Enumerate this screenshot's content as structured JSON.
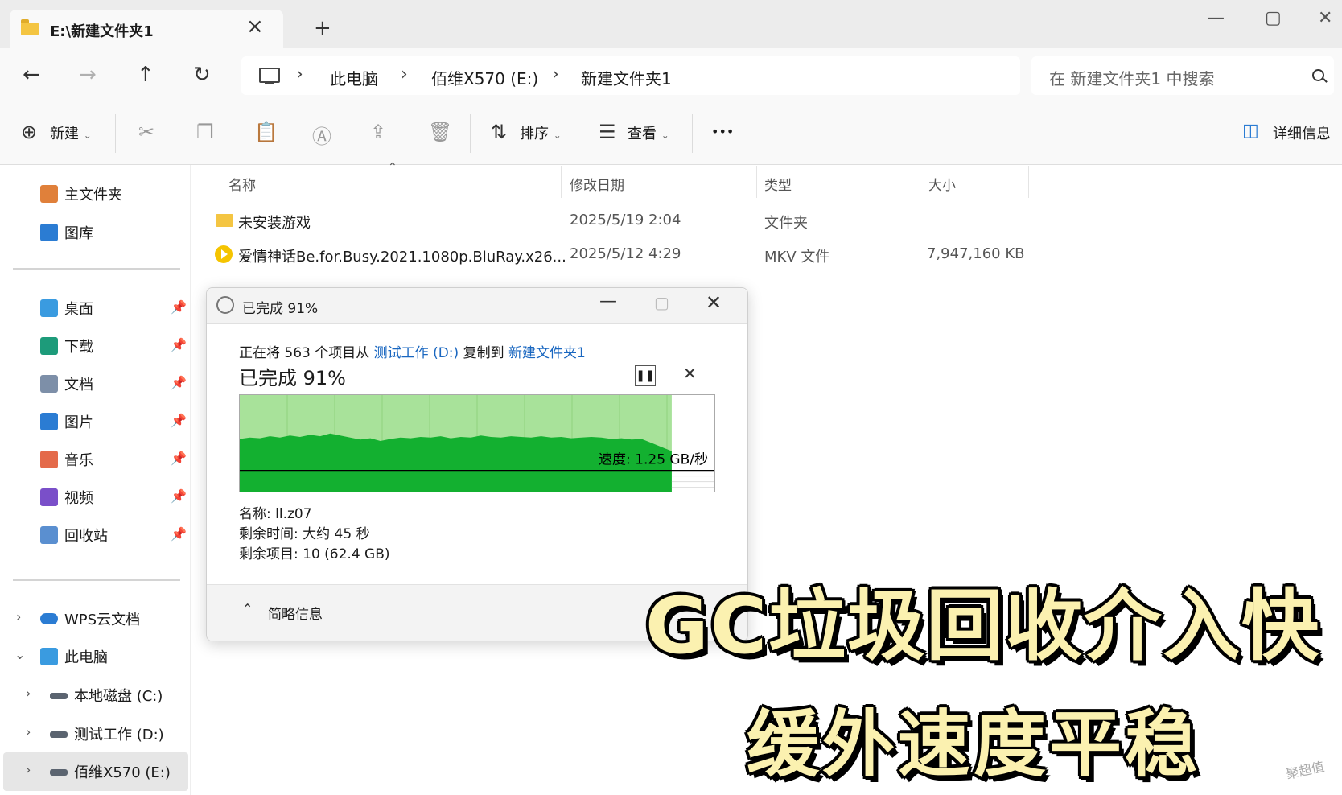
{
  "window": {
    "tab_title": "E:\\新建文件夹1",
    "new_tab": "+",
    "controls": [
      "—",
      "▢",
      "✕"
    ]
  },
  "nav": {
    "breadcrumbs": [
      "此电脑",
      "佰维X570 (E:)",
      "新建文件夹1"
    ],
    "search_placeholder": "在 新建文件夹1 中搜索"
  },
  "commandbar": {
    "new_label": "新建",
    "sort_label": "排序",
    "view_label": "查看",
    "more_label": "•••",
    "details_label": "详细信息"
  },
  "sidebar": {
    "quick": [
      {
        "label": "主文件夹",
        "icon": "home-icon",
        "color": "#e0803a"
      },
      {
        "label": "图库",
        "icon": "gallery-icon",
        "color": "#2b7cd3"
      }
    ],
    "pinned": [
      {
        "label": "桌面",
        "icon": "desktop-icon",
        "color": "#3a9be0"
      },
      {
        "label": "下载",
        "icon": "download-icon",
        "color": "#1d9b7a"
      },
      {
        "label": "文档",
        "icon": "documents-icon",
        "color": "#7d8fa8"
      },
      {
        "label": "图片",
        "icon": "pictures-icon",
        "color": "#2b7cd3"
      },
      {
        "label": "音乐",
        "icon": "music-icon",
        "color": "#e46a4a"
      },
      {
        "label": "视频",
        "icon": "videos-icon",
        "color": "#7a4fc9"
      },
      {
        "label": "回收站",
        "icon": "recycle-bin-icon",
        "color": "#5a8fd0"
      }
    ],
    "tree": [
      {
        "label": "WPS云文档",
        "icon": "cloud-icon"
      },
      {
        "label": "此电脑",
        "icon": "this-pc-icon"
      },
      {
        "label": "本地磁盘 (C:)",
        "icon": "drive-icon"
      },
      {
        "label": "测试工作 (D:)",
        "icon": "drive-icon"
      },
      {
        "label": "佰维X570 (E:)",
        "icon": "drive-icon"
      }
    ]
  },
  "filelist": {
    "columns": [
      "名称",
      "修改日期",
      "类型",
      "大小"
    ],
    "rows": [
      {
        "name": "未安装游戏",
        "date": "2025/5/19 2:04",
        "type": "文件夹",
        "size": ""
      },
      {
        "name": "爱情神话Be.for.Busy.2021.1080p.BluRay.x26...",
        "date": "2025/5/12 4:29",
        "type": "MKV 文件",
        "size": "7,947,160 KB"
      }
    ]
  },
  "dialog": {
    "title": "已完成 91%",
    "line_prefix": "正在将 563 个项目从 ",
    "source": "测试工作 (D:)",
    "line_middle": " 复制到 ",
    "dest": "新建文件夹1",
    "progress_heading": "已完成 91%",
    "progress_fraction": 0.91,
    "speed_label": "速度: 1.25 GB/秒",
    "name_line": "名称:  ll.z07",
    "time_line": "剩余时间: 大约 45 秒",
    "items_line": "剩余项目: 10 (62.4 GB)",
    "footer_label": "简略信息"
  },
  "chart_data": {
    "type": "area",
    "speed_samples": [
      0.78,
      0.8,
      0.79,
      0.82,
      0.8,
      0.83,
      0.81,
      0.84,
      0.82,
      0.86,
      0.83,
      0.8,
      0.77,
      0.79,
      0.75,
      0.78,
      0.8,
      0.79,
      0.81,
      0.8,
      0.82,
      0.79,
      0.81,
      0.8,
      0.83,
      0.81,
      0.8,
      0.82,
      0.81,
      0.8,
      0.82,
      0.8,
      0.81,
      0.79,
      0.8,
      0.81,
      0.8,
      0.78,
      0.79,
      0.77,
      0.78,
      0.72,
      0.66,
      0.6
    ],
    "colors": {
      "progress_bg": "#a8e29a",
      "speed_fill": "#13b030",
      "line": "#000000"
    }
  },
  "overlay": {
    "line1": "GC垃圾回收介入快",
    "line2": "缓外速度平稳",
    "watermark": "聚超值"
  }
}
